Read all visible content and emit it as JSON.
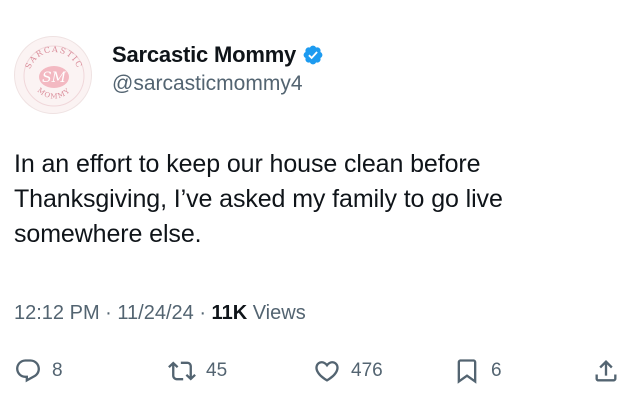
{
  "author": {
    "display_name": "Sarcastic Mommy",
    "handle": "@sarcasticmommy4",
    "verified": true,
    "avatar_text": {
      "top": "SARCASTIC",
      "center": "SM",
      "bottom": "MOMMY"
    }
  },
  "tweet": {
    "text": "In an effort to keep our house clean before Thanksgiving, I’ve asked my family to go live somewhere else."
  },
  "meta": {
    "time": "12:12 PM",
    "separator": "·",
    "date": "11/24/24",
    "views_count": "11K",
    "views_label": "Views"
  },
  "actions": {
    "replies": "8",
    "reposts": "45",
    "likes": "476",
    "bookmarks": "6"
  },
  "colors": {
    "text": "#0f1419",
    "secondary": "#536471",
    "verified_blue": "#1d9bf0",
    "avatar_pink": "#e89aa6"
  }
}
